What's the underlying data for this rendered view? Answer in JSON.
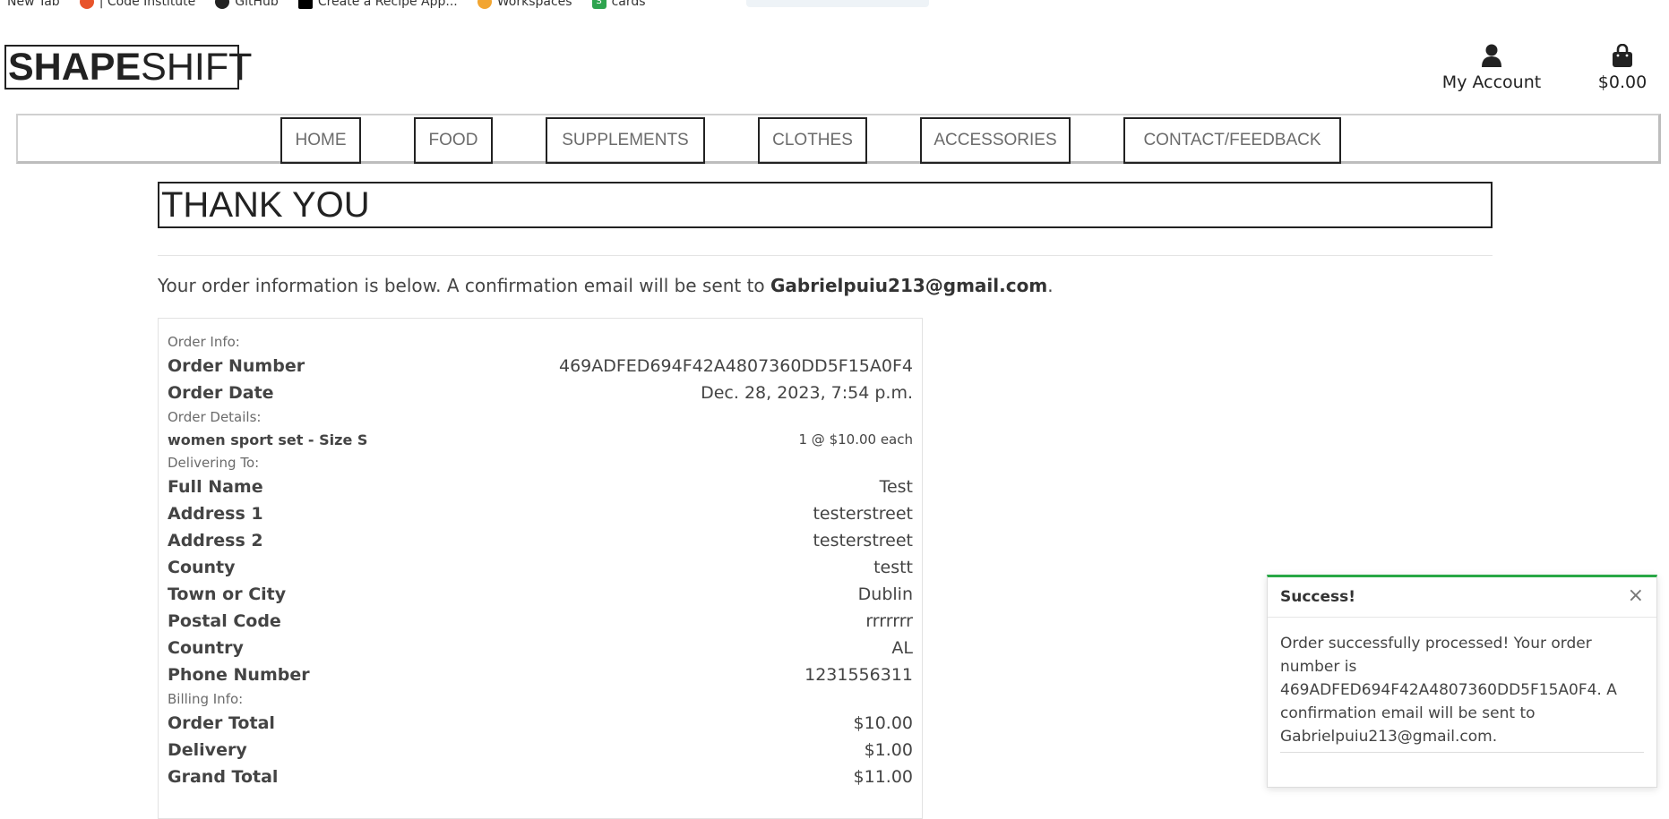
{
  "bookmarks": [
    {
      "label": "New Tab",
      "icon": "new-tab-icon"
    },
    {
      "label": "| Code Institute",
      "icon": "code-institute-icon"
    },
    {
      "label": "GitHub",
      "icon": "github-icon"
    },
    {
      "label": "Create a Recipe App...",
      "icon": "dev-icon"
    },
    {
      "label": "Workspaces",
      "icon": "workspaces-icon"
    },
    {
      "label": "cards",
      "icon": "cards-icon"
    }
  ],
  "brand": {
    "bold": "SHAPE",
    "light": "SHIFT"
  },
  "header": {
    "account_label": "My Account",
    "cart_total": "$0.00"
  },
  "nav": [
    "HOME",
    "FOOD",
    "SUPPLEMENTS",
    "CLOTHES",
    "ACCESSORIES",
    "CONTACT/FEEDBACK"
  ],
  "page": {
    "title": "THANK YOU",
    "intro_text": "Your order information is below. A confirmation email will be sent to ",
    "email": "Gabrielpuiu213@gmail.com",
    "intro_end": "."
  },
  "order": {
    "order_info_heading": "Order Info:",
    "order_number_label": "Order Number",
    "order_number": "469ADFED694F42A4807360DD5F15A0F4",
    "order_date_label": "Order Date",
    "order_date": "Dec. 28, 2023, 7:54 p.m.",
    "details_heading": "Order Details:",
    "item_name": "women sport set - Size S",
    "item_qty": "1 @ $10.00 each",
    "delivery_heading": "Delivering To:",
    "delivery": [
      {
        "label": "Full Name",
        "value": "Test"
      },
      {
        "label": "Address 1",
        "value": "testerstreet"
      },
      {
        "label": "Address 2",
        "value": "testerstreet"
      },
      {
        "label": "County",
        "value": "testt"
      },
      {
        "label": "Town or City",
        "value": "Dublin"
      },
      {
        "label": "Postal Code",
        "value": "rrrrrrr"
      },
      {
        "label": "Country",
        "value": "AL"
      },
      {
        "label": "Phone Number",
        "value": "1231556311"
      }
    ],
    "billing_heading": "Billing Info:",
    "billing": [
      {
        "label": "Order Total",
        "value": "$10.00"
      },
      {
        "label": "Delivery",
        "value": "$1.00"
      },
      {
        "label": "Grand Total",
        "value": "$11.00"
      }
    ]
  },
  "toast": {
    "title": "Success!",
    "close": "×",
    "message": "Order successfully processed! Your order number is 469ADFED694F42A4807360DD5F15A0F4. A confirmation email will be sent to Gabrielpuiu213@gmail.com."
  },
  "colors": {
    "accent_success": "#28a745",
    "text_dark": "#222222"
  }
}
